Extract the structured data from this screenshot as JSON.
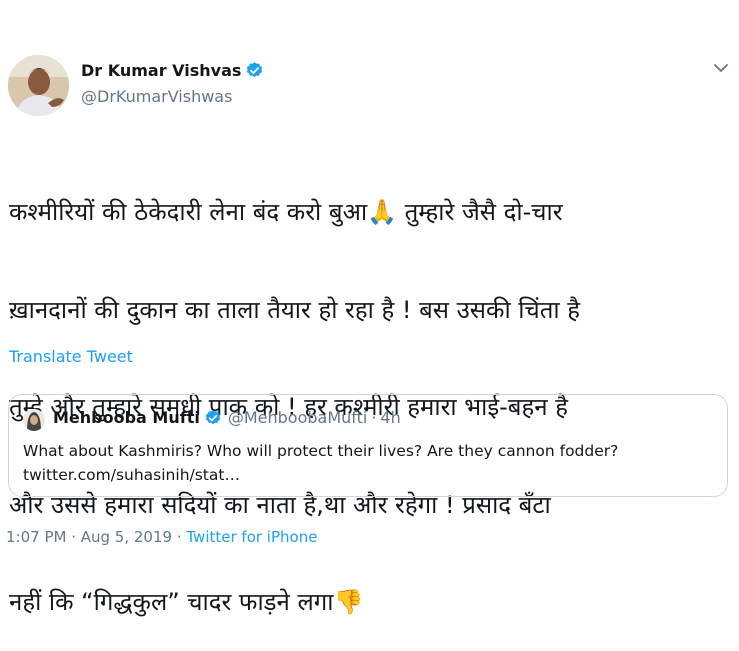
{
  "author": {
    "name": "Dr Kumar Vishvas",
    "handle": "@DrKumarVishwas"
  },
  "tweet": {
    "lines": [
      "कश्मीरियों की ठेकेदारी लेना बंद करो बुआ",
      " तुम्हारे जैसै दो-चार",
      "ख़ानदानों की दुकान का ताला तैयार हो रहा है ! बस उसकी चिंता है",
      "तुम्हे और तुम्हारे समधी पाक को ! हर कश्मीरी हमारा भाई-बहन है",
      "और उससे हमारा सदियों का नाता है,था और रहेगा ! प्रसाद बँटा",
      "नहीं कि “गिद्धकुल” चादर फाड़ने लगा"
    ],
    "emoji_1": "🙏",
    "emoji_2": "👎",
    "translate_label": "Translate Tweet"
  },
  "quote": {
    "name": "Mehbooba Mufti",
    "handle": "@MehboobaMufti",
    "dot": "·",
    "time": "4h",
    "text": "What about Kashmiris? Who will protect their lives? Are they cannon fodder? twitter.com/suhasinih/stat…"
  },
  "footer": {
    "time_date": "1:07 PM · Aug 5, 2019 ·",
    "source": "Twitter for iPhone"
  },
  "colors": {
    "link": "#1da1f2",
    "secondary_text": "#657786",
    "border": "#ccd6dd",
    "verified": "#1da1f2"
  },
  "icons": {
    "verified": "verified-badge-icon",
    "chevron": "chevron-down-icon"
  }
}
